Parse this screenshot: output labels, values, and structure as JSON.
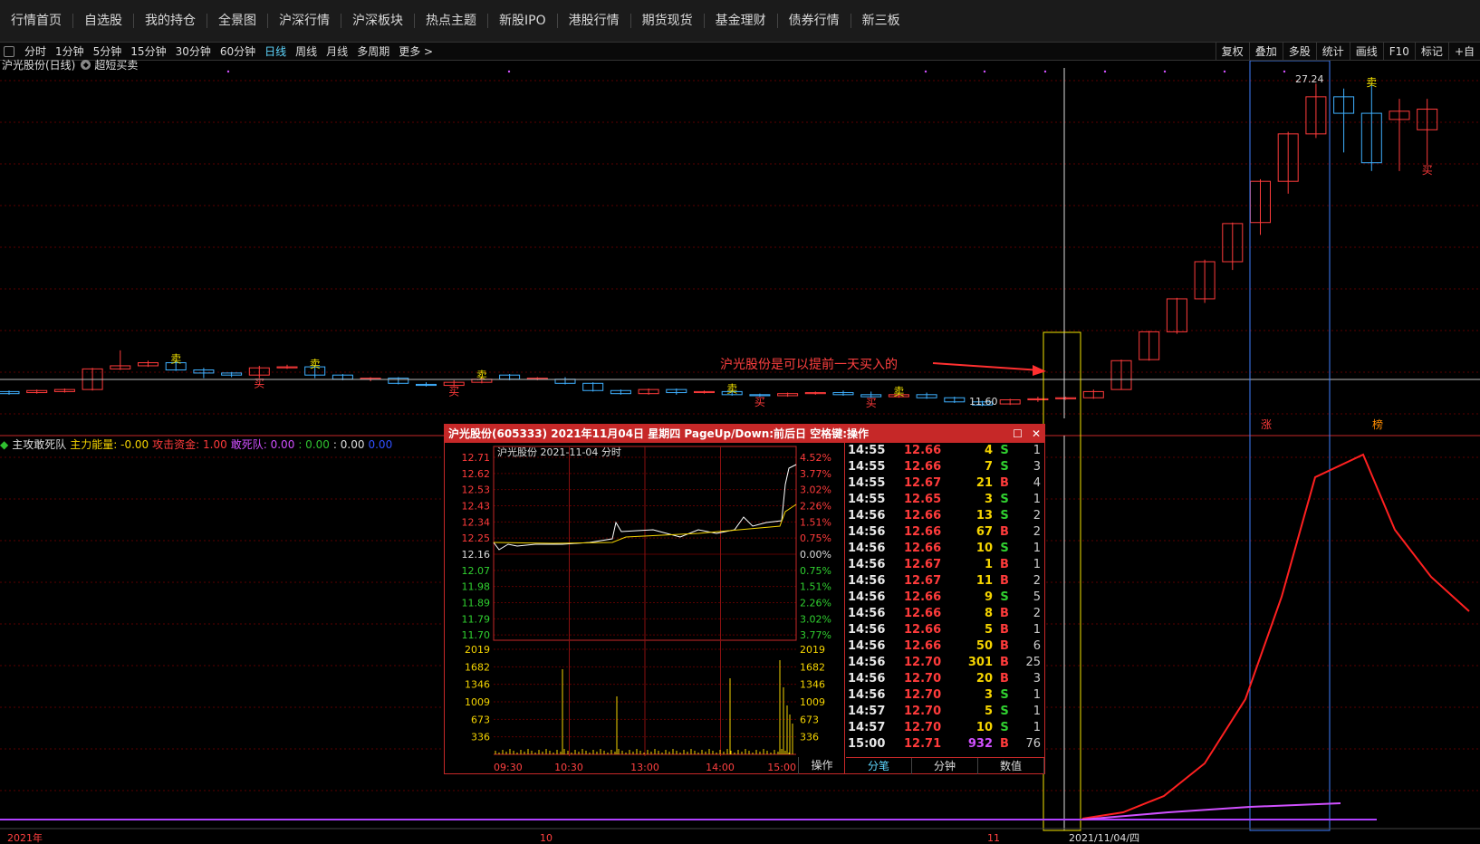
{
  "topnav": [
    "行情首页",
    "自选股",
    "我的持仓",
    "全景图",
    "沪深行情",
    "沪深板块",
    "热点主题",
    "新股IPO",
    "港股行情",
    "期货现货",
    "基金理财",
    "债券行情",
    "新三板"
  ],
  "periods": [
    "分时",
    "1分钟",
    "5分钟",
    "15分钟",
    "30分钟",
    "60分钟",
    "日线",
    "周线",
    "月线",
    "多周期",
    "更多 >"
  ],
  "active_period": "日线",
  "right_tools": [
    "复权",
    "叠加",
    "多股",
    "统计",
    "画线",
    "F10",
    "标记",
    "+自"
  ],
  "chart": {
    "title": "沪光股份(日线)",
    "indicator": "超短买卖",
    "high_label": "27.24",
    "low_label": "11.60",
    "annotation": "沪光股份是可以提前一天买入的",
    "sell_mark": "卖",
    "buy_mark": "买",
    "zhang_mark": "涨",
    "bang_mark": "榜"
  },
  "indicator_legend": {
    "name": "主攻敢死队",
    "items": [
      {
        "label": "主力能量: -0.00",
        "color": "#f5d400"
      },
      {
        "label": "攻击资金: 1.00",
        "color": "#ff3b3b"
      },
      {
        "label": "敢死队: 0.00",
        "color": "#d050ff"
      },
      {
        "label": ": 0.00",
        "color": "#30c030"
      },
      {
        "label": ": 0.00",
        "color": "#dddddd"
      },
      {
        "label": "0.00",
        "color": "#3050ff"
      }
    ]
  },
  "x_axis": {
    "label_2021": "2021年",
    "label_10": "10",
    "label_11": "11",
    "label_date": "2021/11/04/四"
  },
  "popup": {
    "title": "沪光股份(605333) 2021年11月04日 星期四 PageUp/Down:前后日 空格键:操作",
    "mini_title": "沪光股份  2021-11-04 分时",
    "price_labels": [
      "12.71",
      "12.62",
      "12.53",
      "12.43",
      "12.34",
      "12.25",
      "12.16",
      "12.07",
      "11.98",
      "11.89",
      "11.79",
      "11.70"
    ],
    "pct_labels": [
      "4.52%",
      "3.77%",
      "3.02%",
      "2.26%",
      "1.51%",
      "0.75%",
      "0.00%",
      "0.75%",
      "1.51%",
      "2.26%",
      "3.02%",
      "3.77%"
    ],
    "vol_labels": [
      "2019",
      "1682",
      "1346",
      "1009",
      "673",
      "336"
    ],
    "time_labels": [
      "09:30",
      "10:30",
      "13:00",
      "14:00",
      "15:00"
    ],
    "caozuo": "操作",
    "tabs": [
      "分笔",
      "分钟",
      "数值"
    ],
    "active_tab": "分笔",
    "trades": [
      [
        "14:55",
        "12.66",
        "4",
        "S",
        "1"
      ],
      [
        "14:55",
        "12.66",
        "7",
        "S",
        "3"
      ],
      [
        "14:55",
        "12.67",
        "21",
        "B",
        "4"
      ],
      [
        "14:55",
        "12.65",
        "3",
        "S",
        "1"
      ],
      [
        "14:56",
        "12.66",
        "13",
        "S",
        "2"
      ],
      [
        "14:56",
        "12.66",
        "67",
        "B",
        "2"
      ],
      [
        "14:56",
        "12.66",
        "10",
        "S",
        "1"
      ],
      [
        "14:56",
        "12.67",
        "1",
        "B",
        "1"
      ],
      [
        "14:56",
        "12.67",
        "11",
        "B",
        "2"
      ],
      [
        "14:56",
        "12.66",
        "9",
        "S",
        "5"
      ],
      [
        "14:56",
        "12.66",
        "8",
        "B",
        "2"
      ],
      [
        "14:56",
        "12.66",
        "5",
        "B",
        "1"
      ],
      [
        "14:56",
        "12.66",
        "50",
        "B",
        "6"
      ],
      [
        "14:56",
        "12.70",
        "301",
        "B",
        "25"
      ],
      [
        "14:56",
        "12.70",
        "20",
        "B",
        "3"
      ],
      [
        "14:56",
        "12.70",
        "3",
        "S",
        "1"
      ],
      [
        "14:57",
        "12.70",
        "5",
        "S",
        "1"
      ],
      [
        "14:57",
        "12.70",
        "10",
        "S",
        "1"
      ],
      [
        "15:00",
        "12.71",
        "932",
        "B",
        "76"
      ]
    ]
  },
  "colors": {
    "up": "#ff3b3b",
    "down": "#3fb0ff",
    "grid": "#5a0000",
    "popup_border": "#c62828",
    "highlight_yellow": "#f5e400",
    "highlight_blue": "#3f7fff"
  },
  "candles": [
    [
      12.3,
      12.2,
      12.35,
      12.15
    ],
    [
      12.25,
      12.35,
      12.4,
      12.2
    ],
    [
      12.3,
      12.4,
      12.45,
      12.25
    ],
    [
      12.4,
      13.4,
      13.45,
      12.35
    ],
    [
      13.4,
      13.55,
      14.3,
      13.35
    ],
    [
      13.55,
      13.7,
      13.8,
      13.5
    ],
    [
      13.7,
      13.35,
      13.8,
      13.3
    ],
    [
      13.35,
      13.2,
      13.45,
      12.95
    ],
    [
      13.2,
      13.1,
      13.25,
      13.0
    ],
    [
      13.1,
      13.45,
      13.55,
      12.95
    ],
    [
      13.45,
      13.5,
      13.6,
      13.4
    ],
    [
      13.5,
      13.1,
      13.55,
      12.95
    ],
    [
      13.1,
      12.9,
      13.15,
      12.85
    ],
    [
      12.9,
      12.95,
      13.0,
      12.8
    ],
    [
      12.95,
      12.7,
      13.0,
      12.65
    ],
    [
      12.65,
      12.6,
      12.75,
      12.55
    ],
    [
      12.6,
      12.75,
      12.85,
      12.55
    ],
    [
      12.75,
      12.9,
      13.0,
      12.7
    ],
    [
      13.1,
      12.9,
      13.15,
      12.85
    ],
    [
      12.9,
      12.95,
      13.0,
      12.85
    ],
    [
      12.9,
      12.7,
      13.0,
      12.65
    ],
    [
      12.7,
      12.35,
      12.75,
      12.3
    ],
    [
      12.35,
      12.2,
      12.4,
      12.15
    ],
    [
      12.2,
      12.4,
      12.45,
      12.15
    ],
    [
      12.4,
      12.25,
      12.45,
      12.15
    ],
    [
      12.25,
      12.3,
      12.35,
      12.2
    ],
    [
      12.3,
      12.15,
      12.35,
      12.1
    ],
    [
      12.15,
      12.1,
      12.2,
      12.05
    ],
    [
      12.1,
      12.2,
      12.25,
      12.05
    ],
    [
      12.2,
      12.25,
      12.3,
      12.15
    ],
    [
      12.25,
      12.15,
      12.35,
      12.1
    ],
    [
      12.15,
      12.05,
      12.3,
      12.0
    ],
    [
      12.05,
      12.15,
      12.2,
      12.0
    ],
    [
      12.15,
      12.0,
      12.25,
      11.95
    ],
    [
      12.0,
      11.8,
      12.05,
      11.75
    ],
    [
      11.8,
      11.65,
      11.85,
      11.6
    ],
    [
      11.7,
      11.9,
      11.95,
      11.65
    ],
    [
      11.9,
      11.95,
      12.05,
      11.8
    ],
    [
      11.95,
      12.0,
      12.05,
      11.9
    ],
    [
      12.0,
      12.3,
      12.4,
      11.95
    ],
    [
      12.4,
      13.8,
      13.85,
      12.4
    ],
    [
      13.85,
      15.2,
      15.25,
      13.8
    ],
    [
      15.2,
      16.8,
      16.85,
      15.1
    ],
    [
      16.8,
      18.6,
      18.7,
      16.6
    ],
    [
      18.6,
      20.45,
      20.5,
      18.2
    ],
    [
      20.5,
      22.5,
      22.6,
      19.9
    ],
    [
      22.5,
      24.8,
      24.9,
      21.9
    ],
    [
      24.8,
      26.6,
      27.24,
      24.6
    ],
    [
      26.6,
      25.8,
      27.0,
      23.9
    ],
    [
      25.8,
      23.4,
      27.2,
      23.0
    ],
    [
      25.5,
      25.9,
      26.5,
      23.0
    ],
    [
      25.0,
      26.0,
      26.5,
      23.3
    ]
  ]
}
